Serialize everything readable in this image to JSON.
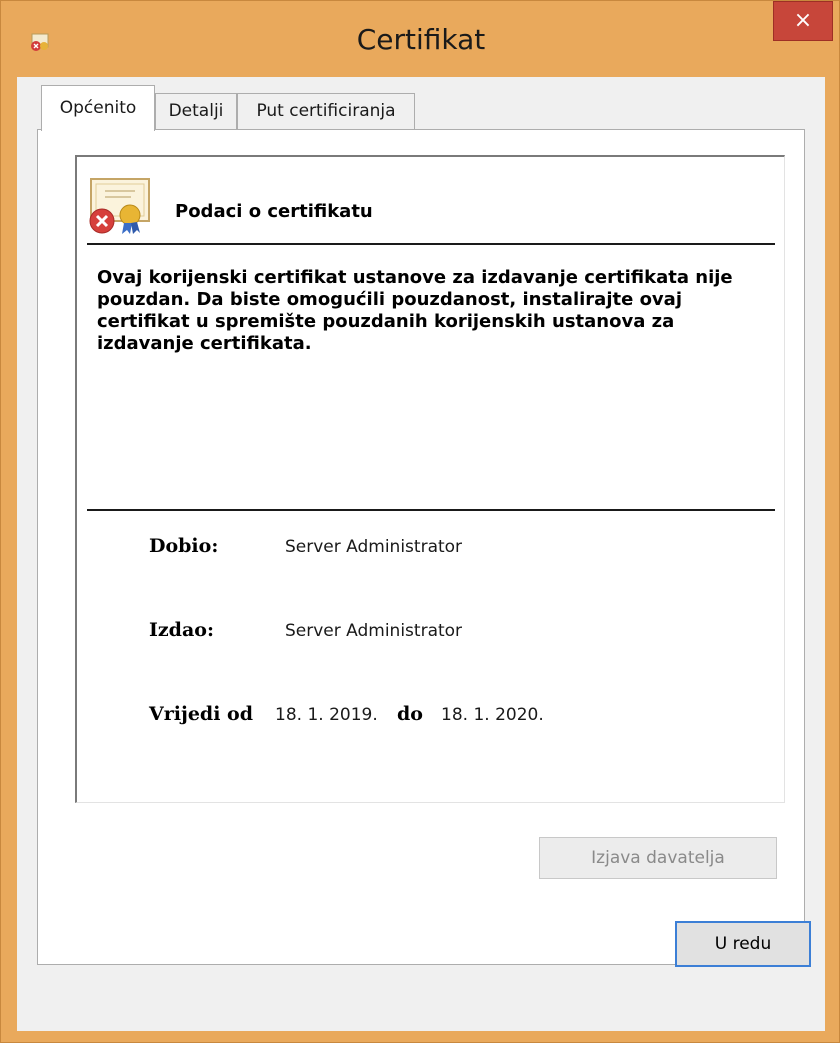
{
  "window": {
    "title": "Certifikat",
    "close_label": "×",
    "icons": {
      "app": "certificate-error-icon",
      "close": "close-icon"
    },
    "colors": {
      "frame": "#e9a95c",
      "close": "#c7463a",
      "focus": "#3c7fd6"
    }
  },
  "tabs": [
    {
      "label": "Općenito",
      "active": true
    },
    {
      "label": "Detalji",
      "active": false
    },
    {
      "label": "Put certificiranja",
      "active": false
    }
  ],
  "info": {
    "heading": "Podaci o certifikatu",
    "icon": "certificate-invalid-icon",
    "message": "Ovaj korijenski certifikat ustanove za izdavanje certifikata nije pouzdan. Da biste omogućili pouzdanost, instalirajte ovaj certifikat u spremište pouzdanih korijenskih ustanova za izdavanje certifikata.",
    "issued_to_label": "Dobio:",
    "issued_to": "Server Administrator",
    "issued_by_label": "Izdao:",
    "issued_by": "Server Administrator",
    "valid_from_label": "Vrijedi od",
    "valid_from": "18. 1. 2019.",
    "valid_to_label": "do",
    "valid_to": "18. 1. 2020."
  },
  "buttons": {
    "issuer_statement": "Izjava davatelja",
    "ok": "U redu"
  }
}
